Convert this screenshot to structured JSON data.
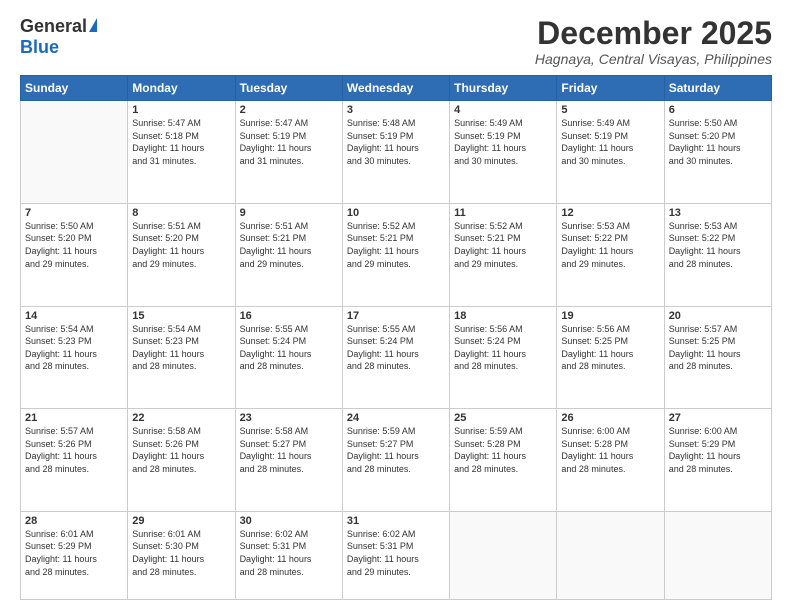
{
  "header": {
    "logo_general": "General",
    "logo_blue": "Blue",
    "month_title": "December 2025",
    "location": "Hagnaya, Central Visayas, Philippines"
  },
  "weekdays": [
    "Sunday",
    "Monday",
    "Tuesday",
    "Wednesday",
    "Thursday",
    "Friday",
    "Saturday"
  ],
  "weeks": [
    [
      {
        "day": "",
        "info": ""
      },
      {
        "day": "1",
        "info": "Sunrise: 5:47 AM\nSunset: 5:18 PM\nDaylight: 11 hours\nand 31 minutes."
      },
      {
        "day": "2",
        "info": "Sunrise: 5:47 AM\nSunset: 5:19 PM\nDaylight: 11 hours\nand 31 minutes."
      },
      {
        "day": "3",
        "info": "Sunrise: 5:48 AM\nSunset: 5:19 PM\nDaylight: 11 hours\nand 30 minutes."
      },
      {
        "day": "4",
        "info": "Sunrise: 5:49 AM\nSunset: 5:19 PM\nDaylight: 11 hours\nand 30 minutes."
      },
      {
        "day": "5",
        "info": "Sunrise: 5:49 AM\nSunset: 5:19 PM\nDaylight: 11 hours\nand 30 minutes."
      },
      {
        "day": "6",
        "info": "Sunrise: 5:50 AM\nSunset: 5:20 PM\nDaylight: 11 hours\nand 30 minutes."
      }
    ],
    [
      {
        "day": "7",
        "info": "Sunrise: 5:50 AM\nSunset: 5:20 PM\nDaylight: 11 hours\nand 29 minutes."
      },
      {
        "day": "8",
        "info": "Sunrise: 5:51 AM\nSunset: 5:20 PM\nDaylight: 11 hours\nand 29 minutes."
      },
      {
        "day": "9",
        "info": "Sunrise: 5:51 AM\nSunset: 5:21 PM\nDaylight: 11 hours\nand 29 minutes."
      },
      {
        "day": "10",
        "info": "Sunrise: 5:52 AM\nSunset: 5:21 PM\nDaylight: 11 hours\nand 29 minutes."
      },
      {
        "day": "11",
        "info": "Sunrise: 5:52 AM\nSunset: 5:21 PM\nDaylight: 11 hours\nand 29 minutes."
      },
      {
        "day": "12",
        "info": "Sunrise: 5:53 AM\nSunset: 5:22 PM\nDaylight: 11 hours\nand 29 minutes."
      },
      {
        "day": "13",
        "info": "Sunrise: 5:53 AM\nSunset: 5:22 PM\nDaylight: 11 hours\nand 28 minutes."
      }
    ],
    [
      {
        "day": "14",
        "info": "Sunrise: 5:54 AM\nSunset: 5:23 PM\nDaylight: 11 hours\nand 28 minutes."
      },
      {
        "day": "15",
        "info": "Sunrise: 5:54 AM\nSunset: 5:23 PM\nDaylight: 11 hours\nand 28 minutes."
      },
      {
        "day": "16",
        "info": "Sunrise: 5:55 AM\nSunset: 5:24 PM\nDaylight: 11 hours\nand 28 minutes."
      },
      {
        "day": "17",
        "info": "Sunrise: 5:55 AM\nSunset: 5:24 PM\nDaylight: 11 hours\nand 28 minutes."
      },
      {
        "day": "18",
        "info": "Sunrise: 5:56 AM\nSunset: 5:24 PM\nDaylight: 11 hours\nand 28 minutes."
      },
      {
        "day": "19",
        "info": "Sunrise: 5:56 AM\nSunset: 5:25 PM\nDaylight: 11 hours\nand 28 minutes."
      },
      {
        "day": "20",
        "info": "Sunrise: 5:57 AM\nSunset: 5:25 PM\nDaylight: 11 hours\nand 28 minutes."
      }
    ],
    [
      {
        "day": "21",
        "info": "Sunrise: 5:57 AM\nSunset: 5:26 PM\nDaylight: 11 hours\nand 28 minutes."
      },
      {
        "day": "22",
        "info": "Sunrise: 5:58 AM\nSunset: 5:26 PM\nDaylight: 11 hours\nand 28 minutes."
      },
      {
        "day": "23",
        "info": "Sunrise: 5:58 AM\nSunset: 5:27 PM\nDaylight: 11 hours\nand 28 minutes."
      },
      {
        "day": "24",
        "info": "Sunrise: 5:59 AM\nSunset: 5:27 PM\nDaylight: 11 hours\nand 28 minutes."
      },
      {
        "day": "25",
        "info": "Sunrise: 5:59 AM\nSunset: 5:28 PM\nDaylight: 11 hours\nand 28 minutes."
      },
      {
        "day": "26",
        "info": "Sunrise: 6:00 AM\nSunset: 5:28 PM\nDaylight: 11 hours\nand 28 minutes."
      },
      {
        "day": "27",
        "info": "Sunrise: 6:00 AM\nSunset: 5:29 PM\nDaylight: 11 hours\nand 28 minutes."
      }
    ],
    [
      {
        "day": "28",
        "info": "Sunrise: 6:01 AM\nSunset: 5:29 PM\nDaylight: 11 hours\nand 28 minutes."
      },
      {
        "day": "29",
        "info": "Sunrise: 6:01 AM\nSunset: 5:30 PM\nDaylight: 11 hours\nand 28 minutes."
      },
      {
        "day": "30",
        "info": "Sunrise: 6:02 AM\nSunset: 5:31 PM\nDaylight: 11 hours\nand 28 minutes."
      },
      {
        "day": "31",
        "info": "Sunrise: 6:02 AM\nSunset: 5:31 PM\nDaylight: 11 hours\nand 29 minutes."
      },
      {
        "day": "",
        "info": ""
      },
      {
        "day": "",
        "info": ""
      },
      {
        "day": "",
        "info": ""
      }
    ]
  ]
}
